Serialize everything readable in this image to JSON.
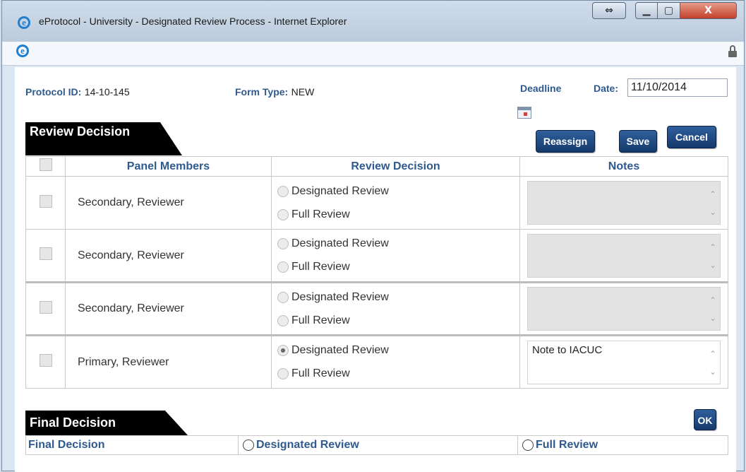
{
  "window": {
    "title": "eProtocol - University - Designated Review Process - Internet Explorer",
    "resize_glyph": "⇔",
    "minimize_glyph": "▁",
    "maximize_glyph": "▢",
    "close_glyph": "X"
  },
  "header": {
    "protocol_id_label": "Protocol ID:",
    "protocol_id_value": "14-10-145",
    "form_type_label": "Form Type:",
    "form_type_value": "NEW",
    "deadline_label": "Deadline",
    "date_label": "Date:",
    "date_value": "11/10/2014"
  },
  "review_section": {
    "title": "Review Decision",
    "buttons": {
      "reassign": "Reassign",
      "save": "Save",
      "cancel": "Cancel"
    },
    "columns": {
      "members": "Panel Members",
      "decision": "Review Decision",
      "notes": "Notes"
    },
    "options": {
      "designated": "Designated Review",
      "full": "Full Review"
    },
    "rows": [
      {
        "member": "Secondary, Reviewer",
        "selected": "none",
        "note": ""
      },
      {
        "member": "Secondary, Reviewer",
        "selected": "none",
        "note": ""
      },
      {
        "member": "Secondary, Reviewer",
        "selected": "none",
        "note": ""
      },
      {
        "member": "Primary, Reviewer",
        "selected": "designated",
        "note": "Note to IACUC"
      }
    ]
  },
  "final_section": {
    "title": "Final Decision",
    "ok_label": "OK",
    "row_label": "Final Decision",
    "option_designated": "Designated Review",
    "option_full": "Full Review"
  },
  "icons": [
    "ie-logo-icon",
    "lock-icon",
    "calendar-icon",
    "scroll-up-icon",
    "scroll-down-icon"
  ]
}
